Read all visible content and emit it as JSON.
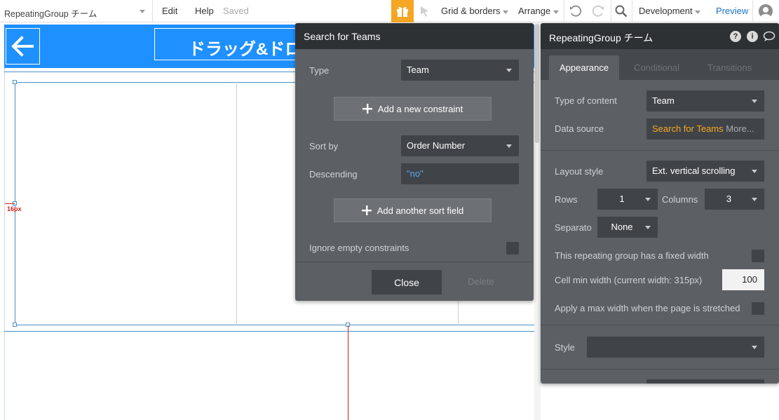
{
  "toolbar": {
    "element_name": "RepeatingGroup チーム",
    "edit": "Edit",
    "help": "Help",
    "saved": "Saved",
    "grid_borders": "Grid & borders",
    "arrange": "Arrange",
    "version": "Development",
    "preview": "Preview",
    "icons": [
      "gift-icon",
      "pointer-icon",
      "undo-icon",
      "redo-icon",
      "search-icon",
      "user-icon"
    ]
  },
  "canvas": {
    "header_title": "ドラッグ&ドロップ",
    "margin_label": "16px",
    "accent": "#1e90ff"
  },
  "search_popup": {
    "title": "Search for Teams",
    "type_label": "Type",
    "type_value": "Team",
    "add_constraint": "Add a new constraint",
    "sort_label": "Sort by",
    "sort_value": "Order Number",
    "descending_label": "Descending",
    "descending_value": "\"no\"",
    "add_sort_field": "Add another sort field",
    "ignore_empty": "Ignore empty constraints",
    "close": "Close",
    "delete": "Delete"
  },
  "property_editor": {
    "title": "RepeatingGroup チーム",
    "tabs": [
      "Appearance",
      "Conditional",
      "Transitions"
    ],
    "type_of_content_label": "Type of content",
    "type_of_content_value": "Team",
    "data_source_label": "Data source",
    "data_source_value": "Search for Teams",
    "data_source_more": "More...",
    "layout_style_label": "Layout style",
    "layout_style_value": "Ext. vertical scrolling",
    "rows_label": "Rows",
    "rows_value": "1",
    "columns_label": "Columns",
    "columns_value": "3",
    "separator_label": "Separato",
    "separator_value": "None",
    "fixed_width_label": "This repeating group has a fixed width",
    "cell_min_width_label": "Cell min width (current width: 315px)",
    "cell_min_width_value": "100",
    "max_width_label": "Apply a max width when the page is stretched",
    "style_label": "Style",
    "style_value": "",
    "orange": "#f5a623"
  }
}
